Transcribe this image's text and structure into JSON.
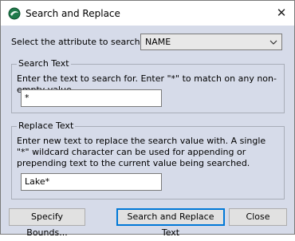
{
  "window": {
    "title": "Search and Replace",
    "close_glyph": "✕"
  },
  "attribute": {
    "label": "Select the attribute to search on:",
    "selected": "NAME"
  },
  "search": {
    "legend": "Search Text",
    "description": "Enter the text to search for. Enter \"*\" to match on any non-empty value.",
    "value": "*"
  },
  "replace": {
    "legend": "Replace Text",
    "description": "Enter new text to replace the search value with. A single \"*\" wildcard character can be used for appending or prepending text to the current value being searched.",
    "value": "Lake*"
  },
  "buttons": {
    "specify_bounds": "Specify Bounds...",
    "search_replace": "Search and Replace Text",
    "close": "Close"
  },
  "colors": {
    "dialog_bg": "#d6dbe9",
    "accent": "#0078d7"
  }
}
